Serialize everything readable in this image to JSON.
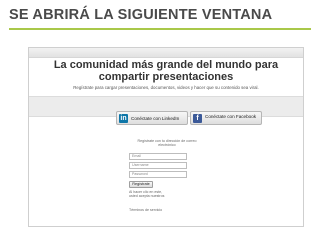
{
  "slide": {
    "title": "SE ABRIRÁ LA SIGUIENTE VENTANA",
    "accent_color": "#a9c84a"
  },
  "screenshot": {
    "headline": "La comunidad más grande del mundo para compartir presentaciones",
    "subline": "Regístrate para cargar presentaciones, documentos, videos y hacer que su contenido sea viral.",
    "linkedin_button": "Conéctate con LinkedIn",
    "linkedin_icon": "in",
    "facebook_button": "Conéctate con Facebook",
    "facebook_icon": "f",
    "or_text": "Regístrate con tu dirección de correo electrónico",
    "email_placeholder": "Email",
    "username_placeholder": "Username",
    "password_placeholder": "Password",
    "submit_label": "Regístrate",
    "terms_text": "Al hacer clic en este, usted acepta nuestros",
    "forgot_text": "Términos de servicio"
  }
}
